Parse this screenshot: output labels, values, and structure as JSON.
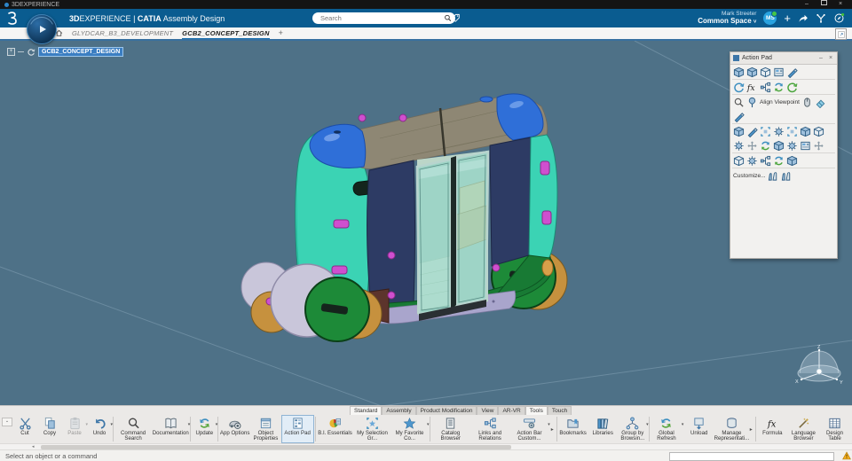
{
  "window": {
    "title": "3DEXPERIENCE"
  },
  "header": {
    "brand_3d": "3D",
    "brand_exp": "EXPERIENCE",
    "sep": "|",
    "app_brand": "CATIA",
    "app_name": "Assembly Design",
    "search_placeholder": "Search",
    "user_name": "Mark Streeter",
    "space_label": "Common Space",
    "avatar_initials": "MS"
  },
  "nav": {
    "tabs": [
      {
        "label": "GLYDCAR_B3_DEVELOPMENT",
        "active": false
      },
      {
        "label": "GCB2_CONCEPT_DESIGN",
        "active": true
      }
    ],
    "add_tab": "+"
  },
  "viewport": {
    "tree_root": "GCB2_CONCEPT_DESIGN",
    "compass": {
      "x": "X",
      "y": "Y",
      "z": "Z"
    }
  },
  "action_pad": {
    "title": "Action Pad",
    "align_viewpoint": "Align Viewpoint",
    "customize": "Customize...",
    "minimize": "–",
    "close": "×"
  },
  "ribbon": {
    "tabs": [
      {
        "label": "Standard",
        "highlight": true
      },
      {
        "label": "Assembly",
        "highlight": false
      },
      {
        "label": "Product Modification",
        "highlight": false
      },
      {
        "label": "View",
        "highlight": false
      },
      {
        "label": "AR-VR",
        "highlight": false
      },
      {
        "label": "Tools",
        "highlight": true
      },
      {
        "label": "Touch",
        "highlight": false
      }
    ],
    "groups": [
      {
        "buttons": [
          {
            "label": "Cut"
          },
          {
            "label": "Copy"
          },
          {
            "label": "Paste"
          },
          {
            "label": "Undo"
          }
        ]
      },
      {
        "buttons": [
          {
            "label": "Command Search"
          },
          {
            "label": "Documentation"
          }
        ]
      },
      {
        "buttons": [
          {
            "label": "Update"
          }
        ]
      },
      {
        "buttons": [
          {
            "label": "App Options"
          },
          {
            "label": "Object Properties"
          },
          {
            "label": "Action Pad"
          }
        ]
      },
      {
        "buttons": [
          {
            "label": "B.I. Essentials"
          },
          {
            "label": "My Selection Gr..."
          },
          {
            "label": "My Favorite Co..."
          }
        ]
      },
      {
        "buttons": [
          {
            "label": "Catalog Browser"
          },
          {
            "label": "Links and Relations"
          },
          {
            "label": "Action Bar Custom..."
          }
        ]
      },
      {
        "buttons": [
          {
            "label": "Bookmarks"
          },
          {
            "label": "Libraries"
          },
          {
            "label": "Group by Browsin..."
          }
        ]
      },
      {
        "buttons": [
          {
            "label": "Global Refresh"
          },
          {
            "label": "Unload"
          },
          {
            "label": "Manage Representati..."
          }
        ]
      },
      {
        "buttons": [
          {
            "label": "Formula"
          },
          {
            "label": "Language Browser"
          },
          {
            "label": "Design Table"
          }
        ]
      }
    ]
  },
  "statusbar": {
    "message": "Select an object or a command"
  },
  "icons": {
    "dropdown": "▾",
    "overflow": "▸",
    "minimize": "–",
    "close": "×",
    "scroll_left": "◂"
  },
  "colors": {
    "header_blue": "#0a5c90",
    "selection_blue": "#3b7ec2",
    "viewport_bg": "#4e7187",
    "toolbar_bg": "#ebe9e7",
    "statusbar_bg": "#f2f1ef",
    "vehicle": {
      "roof_tan": "#8e8774",
      "corner_blue": "#2f6fd8",
      "body_teal": "#3bd3b4",
      "panel_navy": "#2d3b64",
      "skirt_green": "#187a34",
      "rocker_lavender": "#a9a5cc",
      "glass_teal": "#7ed1c4",
      "marker_magenta": "#cf4fcf",
      "wheel_green": "#1d8a38",
      "wheel_tan": "#c6913e",
      "interior_tan": "#d6cc9f",
      "bumper_blue": "#a7c8e8"
    }
  }
}
